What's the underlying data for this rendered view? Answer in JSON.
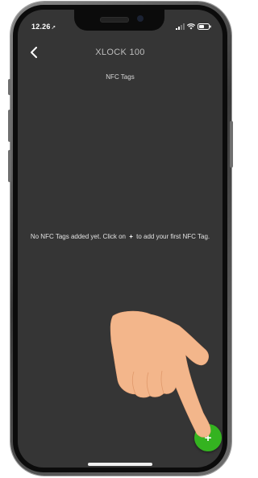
{
  "status_bar": {
    "time": "12.26",
    "location_glyph": "➚"
  },
  "header": {
    "back_icon": "chevron-left-icon",
    "title": "XLOCK 100",
    "subtitle": "NFC Tags"
  },
  "empty_state": {
    "text_before": "No NFC Tags added yet. Click on",
    "plus_glyph": "+",
    "text_after": "to add your first NFC Tag."
  },
  "fab": {
    "label": "+",
    "color": "#34b320"
  },
  "colors": {
    "screen_bg": "#353535",
    "accent_green": "#34b320",
    "hand_skin": "#f3b68b"
  }
}
